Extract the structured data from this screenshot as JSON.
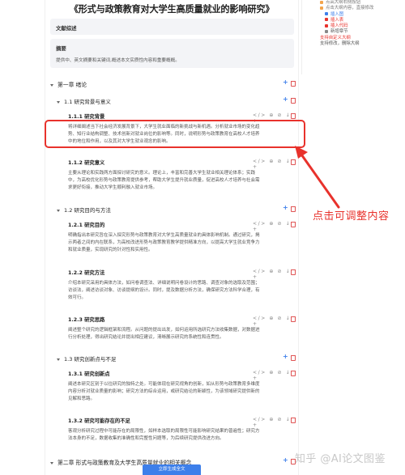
{
  "document": {
    "title": "《形式与政策教育对大学生高质量就业的影响研究》"
  },
  "lit_review": {
    "label": "文献综述"
  },
  "abstract": {
    "label": "摘要",
    "body": "提供中、英文摘要和关键词,概述本文实质性内容和重要概概。"
  },
  "chapter1": {
    "title": "第一章 绪论",
    "s11": {
      "title": "1.1 研究背景与意义",
      "s111_title": "1.1.1 研究背景",
      "s111_text": [
        "将详细阐述当下社会经济发展背景下，大学生就业面临的新挑战与新机遇。分析就业市场的变化趋",
        "势、知行业结构调整、技术创新对就业岗位的影响等。同时，说明形势与政策教育在高校人才培养",
        "中的地位和作用，以及其对大学生就业观念的影响。"
      ],
      "s112_title": "1.1.2 研究意义",
      "s112_text": [
        "主要从理论和实践两方面探讨研究的意义。理论上，丰富和完善大学生就业相关理论体系；实践",
        "中，为高校优化形势与政策教育提供参考，帮助大学生提升就业质量，促进高校人才培养与社会需",
        "求更好衔接，推动大学生顺利融入就业市场。"
      ]
    },
    "s12": {
      "title": "1.2 研究目的与方法",
      "s121_title": "1.2.1 研究目的",
      "s121_text": [
        "明确指出本研究旨在深入探究形势与政策教育对大学生高质量就业的具体影响机制。通过研究，揭",
        "示两者之间的内在联系，为高校改进形势与政策教育教学提供精准方向，以提高大学生就业竞争力",
        "和就业质量，实现研究的针对性和实用性。"
      ],
      "s122_title": "1.2.2 研究方法",
      "s122_text": [
        "介绍本研究采用的具体方法，如问卷调查法、详细说明问卷设计的思路、调查对象的选取及范围；",
        "访谈法，阐述访谈对象、访谈提纲的设计。同时，提及数据分析方法，确保研究方法科学合理，有",
        "效可行。"
      ],
      "s123_title": "1.2.3 研究思路",
      "s123_text": [
        "阐述整个研究的逻辑框架和流程。从问题的提出出发，如何运用所选研究方法收集数据，对数据进",
        "行分析处理，得出研究结论并提出相应建议，清晰展示研究的系统性和连贯性。"
      ]
    },
    "s13": {
      "title": "1.3 研究创新点与不足",
      "s131_title": "1.3.1 研究创新点",
      "s131_text": [
        "阐述本研究区别于以往研究的独特之处。可能体现在研究视角的创新，如从形势与政策教育多维度",
        "内容分析对就业质量的影响；研究方法的综合运用，或研究结论的新颖性，为该领域研究提供新的",
        "见解和思路。"
      ],
      "s132_title": "1.3.2 研究可能存在的不足",
      "s132_text": [
        "客观分析研究过程中可能存在的局限性，如样本选取的局限性可能影响研究结果的普遍性；研究方",
        "法本身的不足，数据收集的准确性和完整性问题等，为后续研究提供改进方向。"
      ]
    }
  },
  "chapter2": {
    "title": "第二章 形式与政策教育及大学生高质量就业的相关概念"
  },
  "ops": {
    "row": "</>  ⊕  ⊘  ↓  +"
  },
  "callout": {
    "text": "点击可调整内容"
  },
  "sidebar": {
    "items": [
      "点高大纲右侧按钮",
      "点击大纲内容，直接修改",
      "插入图",
      "插入表",
      "插入代码",
      "新增章节",
      "支持自定义大纲",
      "支持修改，删除大纲"
    ]
  },
  "bottom_button": {
    "label": "立即生成全文"
  },
  "watermark": {
    "text": "知乎 @AI论文图鉴"
  },
  "colors": {
    "accent": "#3d7fea",
    "highlight": "#e8322c",
    "box_bg": "#f3f4f7"
  }
}
